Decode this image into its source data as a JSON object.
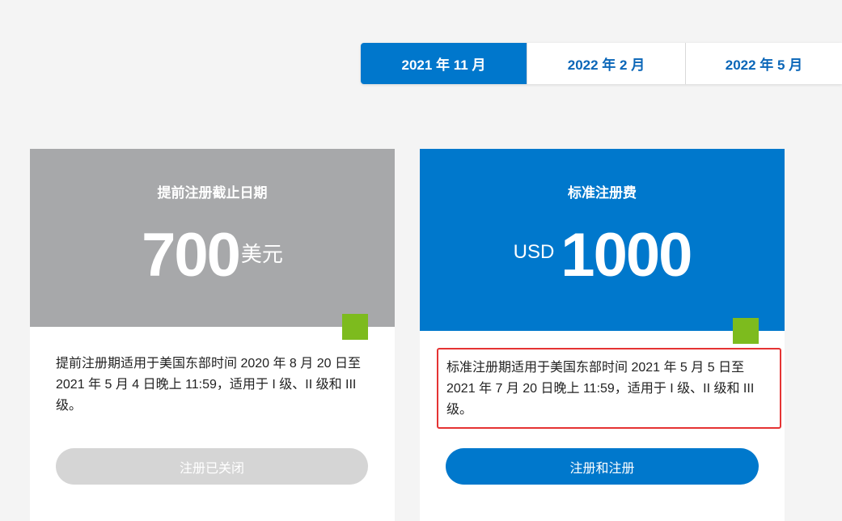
{
  "tabs": [
    {
      "label": "2021 年 11 月",
      "active": true
    },
    {
      "label": "2022 年 2 月",
      "active": false
    },
    {
      "label": "2022 年 5 月",
      "active": false
    }
  ],
  "early_card": {
    "title": "提前注册截止日期",
    "price_amount": "700",
    "price_unit": "美元",
    "description": "提前注册期适用于美国东部时间 2020 年 8 月 20 日至 2021 年 5 月 4 日晚上 11:59，适用于 I 级、II 级和 III 级。",
    "button_label": "注册已关闭"
  },
  "standard_card": {
    "title": "标准注册费",
    "price_currency": "USD",
    "price_amount": "1000",
    "description": "标准注册期适用于美国东部时间 2021 年 5 月 5 日至 2021 年 7 月 20 日晚上 11:59，适用于 I 级、II 级和 III 级。",
    "button_label": "注册和注册"
  },
  "colors": {
    "primary_blue": "#0078cc",
    "early_gray": "#a7a8aa",
    "accent_green": "#7dbb1e",
    "highlight_red": "#e53333",
    "disabled_button": "#d5d5d5"
  }
}
